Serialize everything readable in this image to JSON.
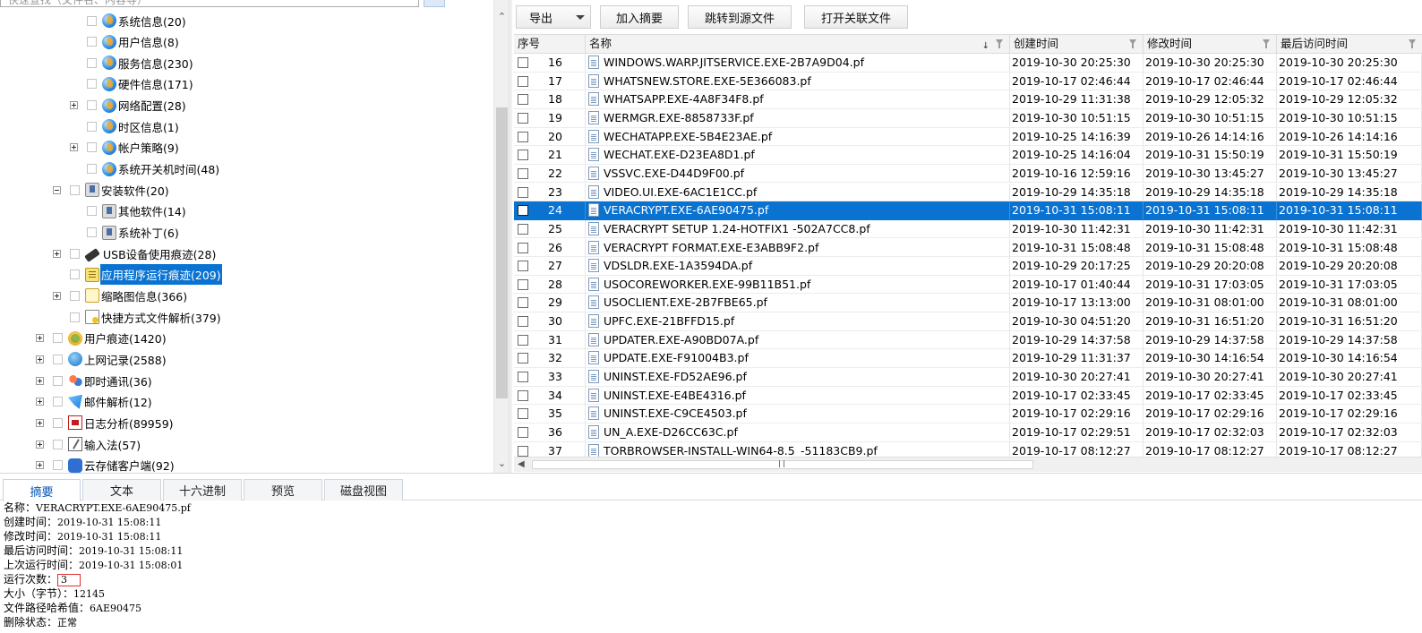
{
  "tree": {
    "search_placeholder": "快速查找（文件名、内容等）",
    "items": [
      {
        "label": "系统信息(20)",
        "icon": "globe-icon",
        "expander": "none"
      },
      {
        "label": "用户信息(8)",
        "icon": "globe-icon",
        "expander": "none"
      },
      {
        "label": "服务信息(230)",
        "icon": "globe-icon",
        "expander": "none"
      },
      {
        "label": "硬件信息(171)",
        "icon": "globe-icon",
        "expander": "none"
      },
      {
        "label": "网络配置(28)",
        "icon": "globe-icon",
        "expander": "plus"
      },
      {
        "label": "时区信息(1)",
        "icon": "globe-icon",
        "expander": "none"
      },
      {
        "label": "帐户策略(9)",
        "icon": "globe-icon",
        "expander": "plus"
      },
      {
        "label": "系统开关机时间(48)",
        "icon": "globe-icon",
        "expander": "none"
      },
      {
        "label": "安装软件(20)",
        "icon": "installer-icon",
        "expander": "minus"
      },
      {
        "label": "其他软件(14)",
        "icon": "installer-icon",
        "expander": "none"
      },
      {
        "label": "系统补丁(6)",
        "icon": "installer-icon",
        "expander": "none"
      },
      {
        "label": "USB设备使用痕迹(28)",
        "icon": "usb-icon",
        "expander": "plus"
      },
      {
        "label": "应用程序运行痕迹(209)",
        "icon": "app-trace-icon",
        "expander": "none"
      },
      {
        "label": "缩略图信息(366)",
        "icon": "thumbnail-icon",
        "expander": "plus"
      },
      {
        "label": "快捷方式文件解析(379)",
        "icon": "shortcut-icon",
        "expander": "none"
      },
      {
        "label": "用户痕迹(1420)",
        "icon": "user-trace-icon",
        "expander": "plus"
      },
      {
        "label": "上网记录(2588)",
        "icon": "web-history-icon",
        "expander": "plus"
      },
      {
        "label": "即时通讯(36)",
        "icon": "instant-message-icon",
        "expander": "plus"
      },
      {
        "label": "邮件解析(12)",
        "icon": "mail-icon",
        "expander": "plus"
      },
      {
        "label": "日志分析(89959)",
        "icon": "log-icon",
        "expander": "plus"
      },
      {
        "label": "输入法(57)",
        "icon": "input-method-icon",
        "expander": "plus"
      },
      {
        "label": "云存储客户端(92)",
        "icon": "cloud-icon",
        "expander": "plus"
      }
    ]
  },
  "toolbar": {
    "export_label": "导出",
    "add_summary_label": "加入摘要",
    "jump_source_label": "跳转到源文件",
    "open_related_label": "打开关联文件"
  },
  "grid": {
    "columns": {
      "seq": "序号",
      "name": "名称",
      "created": "创建时间",
      "modified": "修改时间",
      "accessed": "最后访问时间"
    },
    "rows": [
      {
        "seq": "16",
        "name": "WINDOWS.WARP.JITSERVICE.EXE-2B7A9D04.pf",
        "created": "2019-10-30 20:25:30",
        "modified": "2019-10-30 20:25:30",
        "accessed": "2019-10-30 20:25:30"
      },
      {
        "seq": "17",
        "name": "WHATSNEW.STORE.EXE-5E366083.pf",
        "created": "2019-10-17 02:46:44",
        "modified": "2019-10-17 02:46:44",
        "accessed": "2019-10-17 02:46:44"
      },
      {
        "seq": "18",
        "name": "WHATSAPP.EXE-4A8F34F8.pf",
        "created": "2019-10-29 11:31:38",
        "modified": "2019-10-29 12:05:32",
        "accessed": "2019-10-29 12:05:32"
      },
      {
        "seq": "19",
        "name": "WERMGR.EXE-8858733F.pf",
        "created": "2019-10-30 10:51:15",
        "modified": "2019-10-30 10:51:15",
        "accessed": "2019-10-30 10:51:15"
      },
      {
        "seq": "20",
        "name": "WECHATAPP.EXE-5B4E23AE.pf",
        "created": "2019-10-25 14:16:39",
        "modified": "2019-10-26 14:14:16",
        "accessed": "2019-10-26 14:14:16"
      },
      {
        "seq": "21",
        "name": "WECHAT.EXE-D23EA8D1.pf",
        "created": "2019-10-25 14:16:04",
        "modified": "2019-10-31 15:50:19",
        "accessed": "2019-10-31 15:50:19"
      },
      {
        "seq": "22",
        "name": "VSSVC.EXE-D44D9F00.pf",
        "created": "2019-10-16 12:59:16",
        "modified": "2019-10-30 13:45:27",
        "accessed": "2019-10-30 13:45:27"
      },
      {
        "seq": "23",
        "name": "VIDEO.UI.EXE-6AC1E1CC.pf",
        "created": "2019-10-29 14:35:18",
        "modified": "2019-10-29 14:35:18",
        "accessed": "2019-10-29 14:35:18"
      },
      {
        "seq": "24",
        "name": "VERACRYPT.EXE-6AE90475.pf",
        "created": "2019-10-31 15:08:11",
        "modified": "2019-10-31 15:08:11",
        "accessed": "2019-10-31 15:08:11"
      },
      {
        "seq": "25",
        "name": "VERACRYPT SETUP 1.24-HOTFIX1 -502A7CC8.pf",
        "created": "2019-10-30 11:42:31",
        "modified": "2019-10-30 11:42:31",
        "accessed": "2019-10-30 11:42:31"
      },
      {
        "seq": "26",
        "name": "VERACRYPT FORMAT.EXE-E3ABB9F2.pf",
        "created": "2019-10-31 15:08:48",
        "modified": "2019-10-31 15:08:48",
        "accessed": "2019-10-31 15:08:48"
      },
      {
        "seq": "27",
        "name": "VDSLDR.EXE-1A3594DA.pf",
        "created": "2019-10-29 20:17:25",
        "modified": "2019-10-29 20:20:08",
        "accessed": "2019-10-29 20:20:08"
      },
      {
        "seq": "28",
        "name": "USOCOREWORKER.EXE-99B11B51.pf",
        "created": "2019-10-17 01:40:44",
        "modified": "2019-10-31 17:03:05",
        "accessed": "2019-10-31 17:03:05"
      },
      {
        "seq": "29",
        "name": "USOCLIENT.EXE-2B7FBE65.pf",
        "created": "2019-10-17 13:13:00",
        "modified": "2019-10-31 08:01:00",
        "accessed": "2019-10-31 08:01:00"
      },
      {
        "seq": "30",
        "name": "UPFC.EXE-21BFFD15.pf",
        "created": "2019-10-30 04:51:20",
        "modified": "2019-10-31 16:51:20",
        "accessed": "2019-10-31 16:51:20"
      },
      {
        "seq": "31",
        "name": "UPDATER.EXE-A90BD07A.pf",
        "created": "2019-10-29 14:37:58",
        "modified": "2019-10-29 14:37:58",
        "accessed": "2019-10-29 14:37:58"
      },
      {
        "seq": "32",
        "name": "UPDATE.EXE-F91004B3.pf",
        "created": "2019-10-29 11:31:37",
        "modified": "2019-10-30 14:16:54",
        "accessed": "2019-10-30 14:16:54"
      },
      {
        "seq": "33",
        "name": "UNINST.EXE-FD52AE96.pf",
        "created": "2019-10-30 20:27:41",
        "modified": "2019-10-30 20:27:41",
        "accessed": "2019-10-30 20:27:41"
      },
      {
        "seq": "34",
        "name": "UNINST.EXE-E4BE4316.pf",
        "created": "2019-10-17 02:33:45",
        "modified": "2019-10-17 02:33:45",
        "accessed": "2019-10-17 02:33:45"
      },
      {
        "seq": "35",
        "name": "UNINST.EXE-C9CE4503.pf",
        "created": "2019-10-17 02:29:16",
        "modified": "2019-10-17 02:29:16",
        "accessed": "2019-10-17 02:29:16"
      },
      {
        "seq": "36",
        "name": "UN_A.EXE-D26CC63C.pf",
        "created": "2019-10-17 02:29:51",
        "modified": "2019-10-17 02:32:03",
        "accessed": "2019-10-17 02:32:03"
      },
      {
        "seq": "37",
        "name": "TORBROWSER-INSTALL-WIN64-8.5_-51183CB9.pf",
        "created": "2019-10-17 08:12:27",
        "modified": "2019-10-17 08:12:27",
        "accessed": "2019-10-17 08:12:27"
      }
    ],
    "selected_seq": "24"
  },
  "tabs": [
    {
      "label": "摘要",
      "active": true
    },
    {
      "label": "文本",
      "active": false
    },
    {
      "label": "十六进制",
      "active": false
    },
    {
      "label": "预览",
      "active": false
    },
    {
      "label": "磁盘视图",
      "active": false
    }
  ],
  "summary": {
    "lines": [
      {
        "key": "名称：",
        "value": "VERACRYPT.EXE-6AE90475.pf"
      },
      {
        "key": "创建时间：",
        "value": "2019-10-31 15:08:11"
      },
      {
        "key": "修改时间：",
        "value": "2019-10-31 15:08:11"
      },
      {
        "key": "最后访问时间：",
        "value": "2019-10-31 15:08:11"
      },
      {
        "key": "上次运行时间：",
        "value": "2019-10-31 15:08:01"
      },
      {
        "key": "运行次数：",
        "value": "3",
        "highlight": true
      },
      {
        "key": "大小（字节）：",
        "value": "12145"
      },
      {
        "key": "文件路径哈希值：",
        "value": "6AE90475"
      },
      {
        "key": "删除状态：",
        "value": "正常"
      }
    ]
  },
  "colors": {
    "selection": "#0a73d1",
    "highlight_box": "#e03030"
  }
}
